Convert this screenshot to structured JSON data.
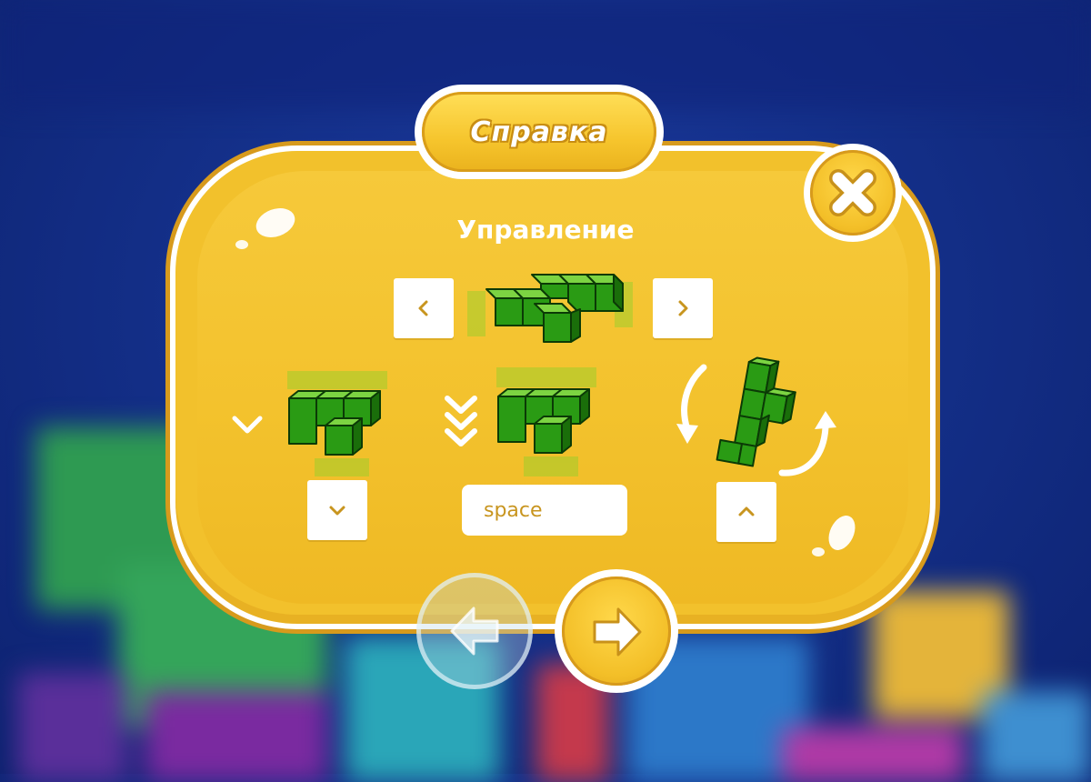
{
  "dialog": {
    "title": "Справка",
    "section_title": "Управление"
  },
  "controls": {
    "move_left_key": "left-arrow-key",
    "move_right_key": "right-arrow-key",
    "soft_drop_key": "down-arrow-key",
    "hard_drop_key_label": "space",
    "rotate_key": "up-arrow-key"
  },
  "navigation": {
    "prev_enabled": false,
    "next_enabled": true
  },
  "colors": {
    "panel": "#f2c12c",
    "panel_border": "#d79a1c",
    "key_glyph": "#c8951f",
    "block_green": "#2c9d16",
    "background": "#14308a"
  }
}
